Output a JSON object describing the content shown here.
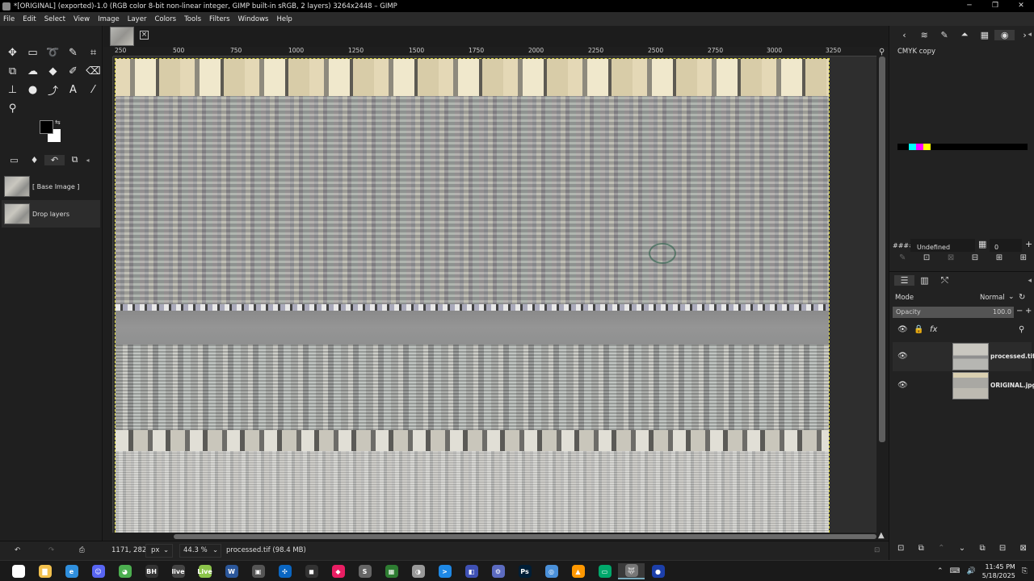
{
  "window": {
    "title": "*[ORIGINAL] (exported)-1.0 (RGB color 8-bit non-linear integer, GIMP built-in sRGB, 2 layers) 3264x2448 – GIMP",
    "minimize": "─",
    "restore": "❐",
    "close": "✕"
  },
  "menu": [
    "File",
    "Edit",
    "Select",
    "View",
    "Image",
    "Layer",
    "Colors",
    "Tools",
    "Filters",
    "Windows",
    "Help"
  ],
  "toolbox": {
    "tools": [
      {
        "name": "move-tool-icon",
        "glyph": "✥"
      },
      {
        "name": "rect-select-tool-icon",
        "glyph": "▭"
      },
      {
        "name": "lasso-tool-icon",
        "glyph": "➰"
      },
      {
        "name": "fuzzy-select-tool-icon",
        "glyph": "✎"
      },
      {
        "name": "crop-tool-icon",
        "glyph": "⌗"
      },
      {
        "name": "transform-tool-icon",
        "glyph": "⧉"
      },
      {
        "name": "warp-tool-icon",
        "glyph": "☁"
      },
      {
        "name": "bucket-fill-tool-icon",
        "glyph": "◆"
      },
      {
        "name": "paintbrush-tool-icon",
        "glyph": "✐"
      },
      {
        "name": "eraser-tool-icon",
        "glyph": "⌫"
      },
      {
        "name": "clone-tool-icon",
        "glyph": "⊥"
      },
      {
        "name": "smudge-tool-icon",
        "glyph": "●"
      },
      {
        "name": "paths-tool-icon",
        "glyph": "⤴"
      },
      {
        "name": "text-tool-icon",
        "glyph": "A"
      },
      {
        "name": "color-picker-tool-icon",
        "glyph": "⁄"
      },
      {
        "name": "zoom-tool-icon",
        "glyph": "⚲"
      }
    ],
    "swap_glyph": "⇆",
    "dock_tabs": [
      {
        "name": "tool-options-tab-icon",
        "glyph": "▭"
      },
      {
        "name": "device-status-tab-icon",
        "glyph": "♦"
      },
      {
        "name": "undo-history-tab-icon",
        "glyph": "↶"
      },
      {
        "name": "images-tab-icon",
        "glyph": "⧉"
      }
    ],
    "dock_menu": "◂",
    "undo_items": [
      "[ Base Image ]",
      "Drop layers"
    ]
  },
  "image_tab": {
    "close": "×"
  },
  "ruler": {
    "labels": [
      "250",
      "500",
      "750",
      "1000",
      "1250",
      "1500",
      "1750",
      "2000",
      "2250",
      "2500",
      "2750",
      "3000",
      "3250"
    ]
  },
  "status": {
    "coords": "1171, 282",
    "unit": "px",
    "zoom": "44.3 %",
    "info": "processed.tif (98.4 MB)",
    "dropdown": "⌄"
  },
  "right_dock": {
    "tabs": [
      {
        "name": "nav-left-icon",
        "glyph": "‹"
      },
      {
        "name": "fonts-tab-icon",
        "glyph": "≋"
      },
      {
        "name": "brushes-tab-icon",
        "glyph": "✎"
      },
      {
        "name": "patterns-tab-icon",
        "glyph": "⏶"
      },
      {
        "name": "palettes-tab-icon",
        "glyph": "▦"
      },
      {
        "name": "gradients-tab-icon",
        "glyph": "◉"
      },
      {
        "name": "nav-right-icon",
        "glyph": "›"
      }
    ],
    "tab_menu": "◂",
    "palette_name": "CMYK copy",
    "palette_colors": [
      "#00ffff",
      "#ff00ff",
      "#ffff00"
    ],
    "palette_hash": "####",
    "palette_entry": "Undefined",
    "palette_columns": "0",
    "palette_buttons": [
      "✎",
      "⊡",
      "⊠",
      "⊟",
      "⊞",
      "⊞"
    ],
    "layer_tabs": [
      {
        "name": "layers-tab-icon",
        "glyph": "☰"
      },
      {
        "name": "channels-tab-icon",
        "glyph": "▥"
      },
      {
        "name": "paths-tab-icon",
        "glyph": "⤲"
      }
    ],
    "mode_label": "Mode",
    "mode_value": "Normal",
    "opacity_label": "Opacity",
    "opacity_value": "100.0",
    "lock_icons": [
      "👁",
      "🔒",
      "fx",
      "⚲"
    ],
    "layers": [
      {
        "name": "processed.tif"
      },
      {
        "name": "ORIGINAL.jpg"
      }
    ],
    "eye_glyph": "👁",
    "layer_buttons": [
      "⊡",
      "⧉",
      "⌃",
      "⌄",
      "⧉",
      "⊟",
      "⊠"
    ]
  },
  "taskbar": {
    "apps": [
      {
        "label": "⊞",
        "color": "#ffffff"
      },
      {
        "label": "▇",
        "color": "#f2c14e"
      },
      {
        "label": "e",
        "color": "#2f8fdd"
      },
      {
        "label": "☺",
        "color": "#5865f2"
      },
      {
        "label": "◕",
        "color": "#4caf50"
      },
      {
        "label": "BH",
        "color": "#333333"
      },
      {
        "label": "live",
        "color": "#444444"
      },
      {
        "label": "Live",
        "color": "#8bc34a"
      },
      {
        "label": "W",
        "color": "#2b579a"
      },
      {
        "label": "▣",
        "color": "#555555"
      },
      {
        "label": "✣",
        "color": "#0a66c2"
      },
      {
        "label": "◼",
        "color": "#333333"
      },
      {
        "label": "◆",
        "color": "#e91e63"
      },
      {
        "label": "S",
        "color": "#666666"
      },
      {
        "label": "▦",
        "color": "#2e7d32"
      },
      {
        "label": "◑",
        "color": "#999999"
      },
      {
        "label": ">",
        "color": "#1e88e5"
      },
      {
        "label": "◧",
        "color": "#3f51b5"
      },
      {
        "label": "⚙",
        "color": "#5c6bc0"
      },
      {
        "label": "Ps",
        "color": "#001e36"
      },
      {
        "label": "◎",
        "color": "#4a90d9"
      },
      {
        "label": "▲",
        "color": "#ff9800"
      },
      {
        "label": "▭",
        "color": "#00a86b"
      },
      {
        "label": "🐺",
        "color": "#777777"
      },
      {
        "label": "●",
        "color": "#1c3faa"
      }
    ],
    "tray": [
      "⌃",
      "⌨",
      "🔊",
      "⎘"
    ],
    "time": "11:45 PM",
    "date": "5/18/2025"
  }
}
